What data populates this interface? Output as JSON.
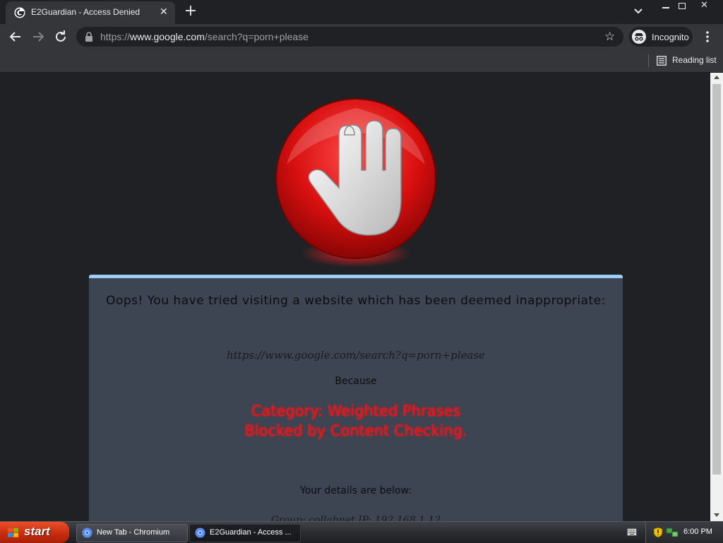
{
  "browser": {
    "tab": {
      "title": "E2Guardian - Access Denied",
      "close_icon": "close-icon"
    },
    "new_tab_label": "+",
    "address": {
      "scheme": "https://",
      "host": "www.google.com",
      "path": "/search?q=porn+please"
    },
    "incognito_label": "Incognito",
    "reading_list_label": "Reading list"
  },
  "page": {
    "message": "Oops! You have tried visiting a website which has been deemed inappropriate:",
    "blocked_url": "https://www.google.com/search?q=porn+please",
    "because_label": "Because",
    "reason_line1": "Category: Weighted Phrases",
    "reason_line2": "Blocked by Content Checking.",
    "details_label": "Your details are below:",
    "group_line": "Group: collabnet   IP: 192.168.1.12"
  },
  "taskbar": {
    "start_label": "start",
    "tasks": [
      {
        "label": "New Tab - Chromium"
      },
      {
        "label": "E2Guardian - Access ..."
      }
    ],
    "clock": "6:00 PM"
  },
  "colors": {
    "page_bg": "#202124",
    "panel_bg": "#3d4452",
    "panel_accent": "#9ccdf2",
    "reason_red": "#e8141c",
    "stop_red": "#e01616"
  }
}
